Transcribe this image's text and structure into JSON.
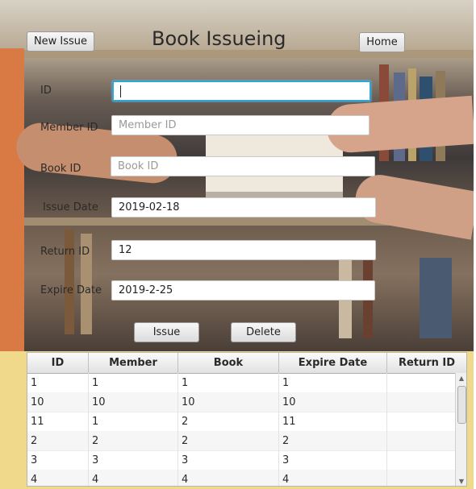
{
  "header": {
    "new_issue_label": "New Issue",
    "title": "Book Issueing",
    "home_label": "Home"
  },
  "form": {
    "id": {
      "label": "ID",
      "value": ""
    },
    "member_id": {
      "label": "Member ID",
      "placeholder": "Member ID",
      "value": ""
    },
    "book_id": {
      "label": "Book ID",
      "placeholder": "Book ID",
      "value": ""
    },
    "issue_date": {
      "label": "Issue Date",
      "value": "2019-02-18"
    },
    "return_id": {
      "label": "Return ID",
      "value": "12"
    },
    "expire_date": {
      "label": "Expire Date",
      "value": "2019-2-25"
    }
  },
  "actions": {
    "issue_label": "Issue",
    "delete_label": "Delete"
  },
  "table": {
    "columns": [
      "ID",
      "Member",
      "Book",
      "Expire Date",
      "Return ID"
    ],
    "rows": [
      [
        "1",
        "1",
        "1",
        "1",
        ""
      ],
      [
        "10",
        "10",
        "10",
        "10",
        ""
      ],
      [
        "11",
        "1",
        "2",
        "11",
        ""
      ],
      [
        "2",
        "2",
        "2",
        "2",
        ""
      ],
      [
        "3",
        "3",
        "3",
        "3",
        ""
      ],
      [
        "4",
        "4",
        "4",
        "4",
        ""
      ]
    ]
  },
  "icons": {
    "scroll_up": "scroll-up-arrow-icon",
    "scroll_down": "scroll-down-arrow-icon"
  },
  "colors": {
    "focus_border": "#2fa6d6",
    "table_panel": "#f1d98b"
  }
}
